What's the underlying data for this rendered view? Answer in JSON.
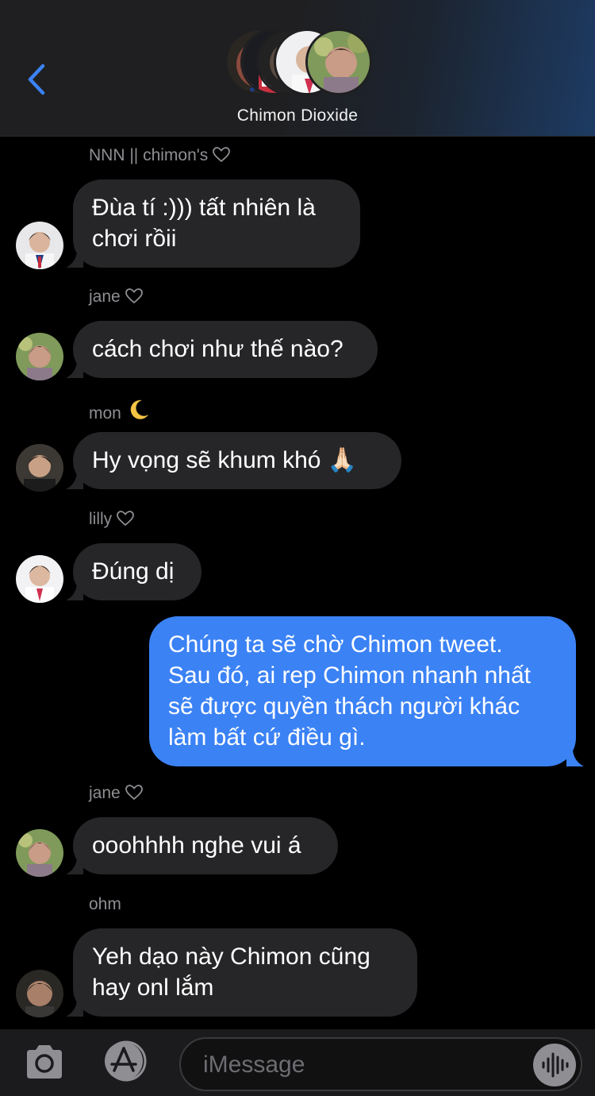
{
  "header": {
    "group_name": "Chimon Dioxide",
    "back_icon": "chevron-left-icon",
    "accent_color": "#3b82f5"
  },
  "messages": [
    {
      "sender": "NNN || chimon's",
      "sender_icon": "heart-outline-icon",
      "text_lines": [
        "Đùa tí :))) tất nhiên là",
        "chơi rồii"
      ]
    },
    {
      "sender": "jane",
      "sender_icon": "heart-outline-icon",
      "text_lines": [
        "cách chơi như thế nào?"
      ]
    },
    {
      "sender": "mon",
      "sender_icon": "crescent-moon-icon",
      "text_lines": [
        "Hy vọng sẽ khum khó 🙏🏻"
      ]
    },
    {
      "sender": "lilly",
      "sender_icon": "heart-outline-icon",
      "text_lines": [
        "Đúng dị"
      ]
    },
    {
      "outgoing": true,
      "text_lines": [
        "Chúng ta sẽ chờ Chimon tweet.",
        "Sau đó, ai rep Chimon nhanh nhất",
        "sẽ được quyền thách người khác",
        "làm bất cứ điều gì."
      ]
    },
    {
      "sender": "jane",
      "sender_icon": "heart-outline-icon",
      "text_lines": [
        "ooohhhh nghe vui á"
      ]
    },
    {
      "sender": "ohm",
      "text_lines": [
        "Yeh dạo này Chimon cũng",
        "hay onl lắm"
      ]
    }
  ],
  "composer": {
    "placeholder": "iMessage",
    "camera_icon": "camera-icon",
    "apps_icon": "app-store-icon",
    "audio_icon": "audio-waveform-icon"
  }
}
